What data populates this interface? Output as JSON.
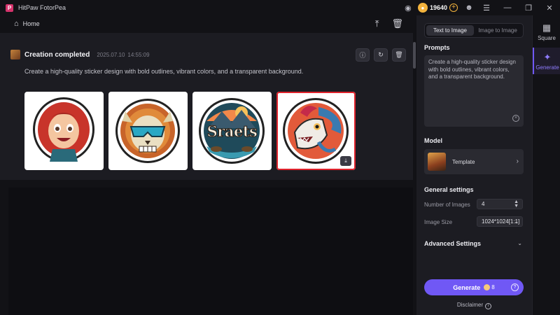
{
  "titlebar": {
    "app_name": "HitPaw FotorPea",
    "logo_letter": "P",
    "coin_count": "19640"
  },
  "homebar": {
    "home_label": "Home"
  },
  "creation": {
    "title": "Creation completed",
    "date": "2025.07.10",
    "time": "14:55:09",
    "prompt": "Create a high-quality sticker design with bold outlines, vibrant colors, and a transparent background.",
    "images": [
      {
        "icon": "red-hair-girl-sticker"
      },
      {
        "icon": "skull-sunglasses-sticker"
      },
      {
        "icon": "mountain-lake-sticker",
        "text": "Sraets"
      },
      {
        "icon": "wolf-dragon-sticker"
      }
    ]
  },
  "panel": {
    "tabs": [
      {
        "label": "Text to Image",
        "active": true
      },
      {
        "label": "Image to Image",
        "active": false
      }
    ],
    "prompts_title": "Prompts",
    "prompt_value": "Create a high-quality sticker design with bold outlines, vibrant colors, and a transparent background.",
    "model_title": "Model",
    "model_name": "Template",
    "general_title": "General settings",
    "num_images_label": "Number of Images",
    "num_images_value": "4",
    "image_size_label": "Image Size",
    "image_size_value": "1024*1024[1:1]",
    "advanced_title": "Advanced Settings",
    "generate_label": "Generate",
    "generate_cost": "8",
    "disclaimer": "Disclaimer"
  },
  "nav": {
    "items": [
      {
        "label": "Square",
        "icon": "grid-icon"
      },
      {
        "label": "Generate",
        "icon": "sparkle-icon",
        "active": true
      }
    ]
  },
  "colors": {
    "accent": "#7058f5",
    "selected_border": "#e0232c",
    "coin": "#f3b33d"
  }
}
